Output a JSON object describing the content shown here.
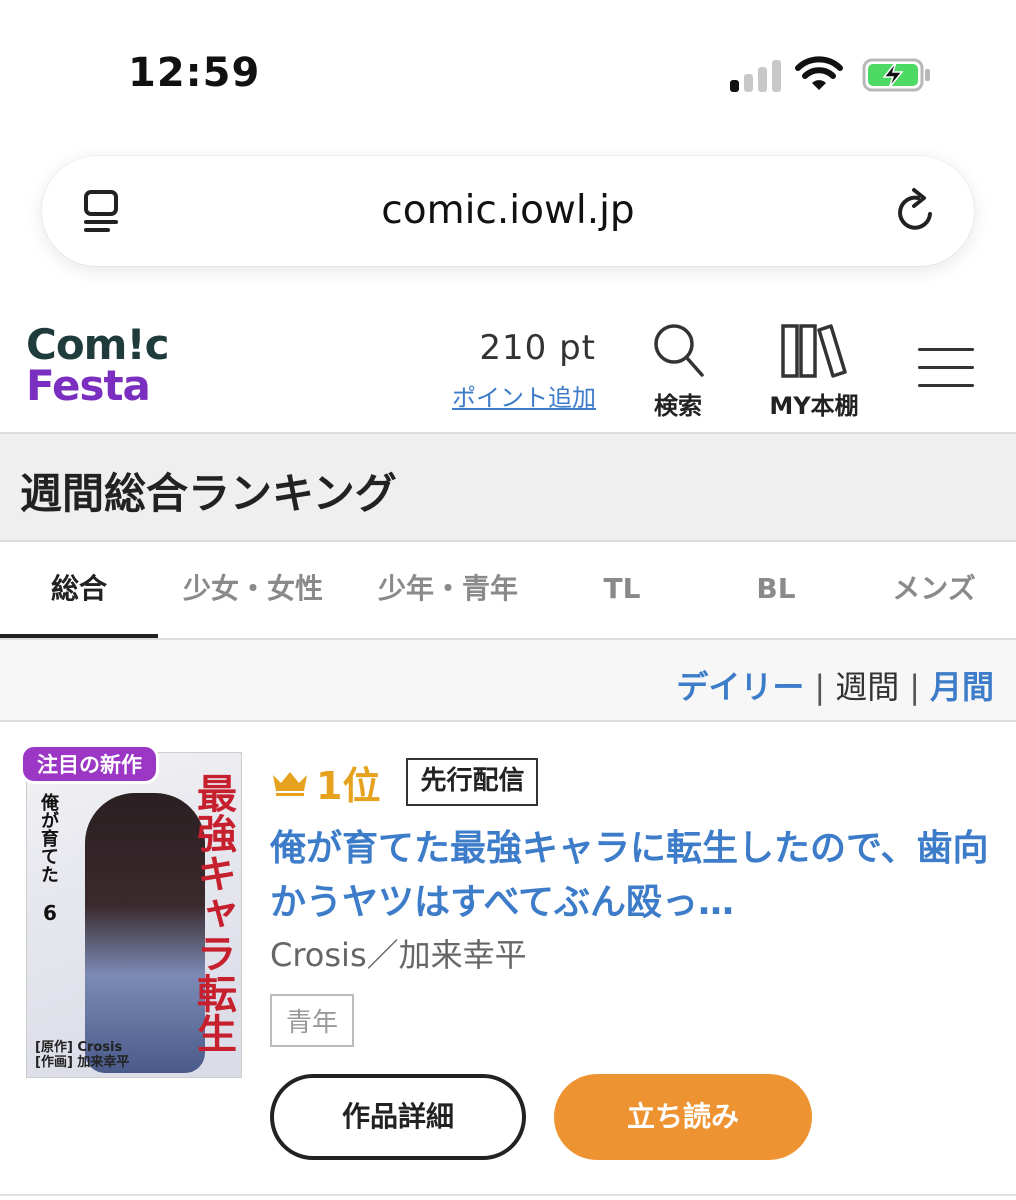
{
  "status": {
    "time": "12:59",
    "signal_bars_on": 1,
    "signal_bars_total": 4,
    "battery": "charging"
  },
  "browser": {
    "url": "comic.iowl.jp"
  },
  "site": {
    "logo_line1": "Com!c",
    "logo_line2": "Festa",
    "points_value": "210 pt",
    "points_link": "ポイント追加",
    "search_label": "検索",
    "shelf_label": "MY本棚"
  },
  "ranking": {
    "heading": "週間総合ランキング",
    "tabs": [
      {
        "label": "総合",
        "active": true
      },
      {
        "label": "少女・女性",
        "active": false
      },
      {
        "label": "少年・青年",
        "active": false
      },
      {
        "label": "TL",
        "active": false
      },
      {
        "label": "BL",
        "active": false
      },
      {
        "label": "メンズ",
        "active": false
      }
    ],
    "periods": {
      "daily": "デイリー",
      "weekly": "週間",
      "monthly": "月間",
      "separator": "|"
    }
  },
  "item": {
    "badge": "注目の新作",
    "cover": {
      "title_red": "最強キャラ転生",
      "subtitle": "俺が育てた",
      "volume": "6",
      "credit_line1": "[原作] Crosis",
      "credit_line2": "[作画] 加来幸平"
    },
    "rank": "1位",
    "tag": "先行配信",
    "title": "俺が育てた最強キャラに転生したので、歯向かうヤツはすべてぶん殴っ…",
    "author": "Crosis／加来幸平",
    "genre": "青年",
    "detail_button": "作品詳細",
    "read_button": "立ち読み"
  },
  "colors": {
    "accent_blue": "#3d7cc9",
    "crown_gold": "#e6a21e",
    "read_orange": "#ee9331",
    "badge_purple": "#9b37c4",
    "logo_purple": "#7a2fc0"
  }
}
